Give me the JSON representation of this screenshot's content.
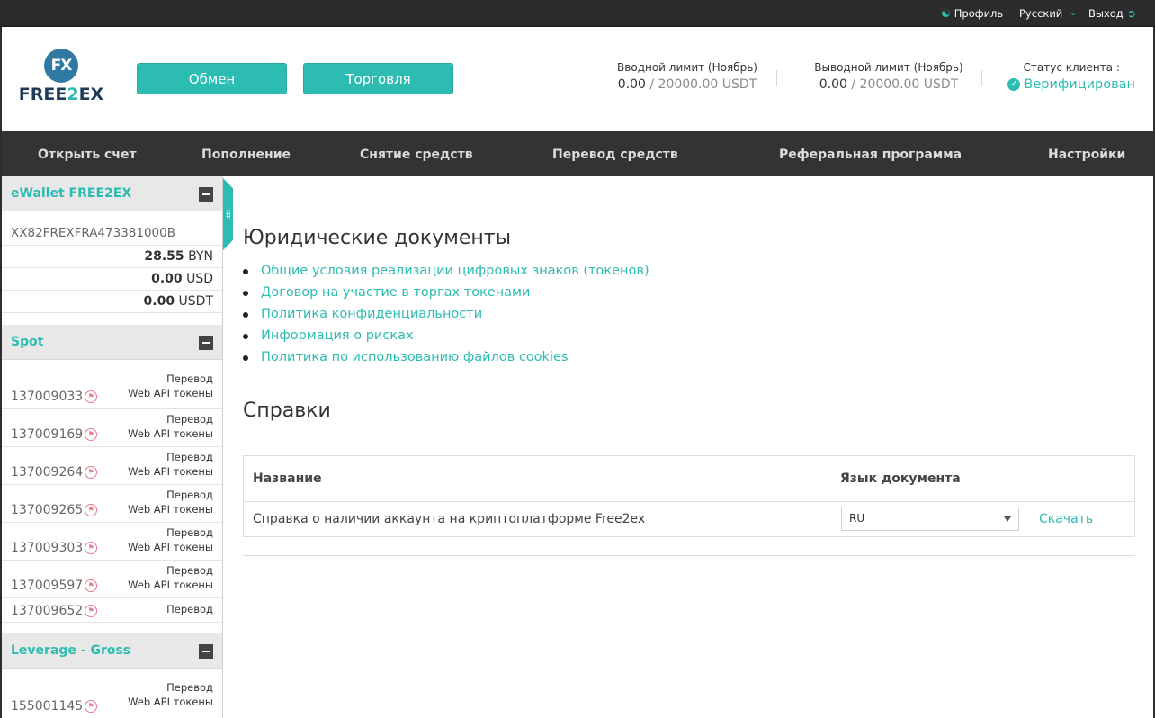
{
  "topbar": {
    "profile": "Профиль",
    "language": "Русский",
    "logout": "Выход"
  },
  "logo": {
    "mark": "FX",
    "text_a": "FREE",
    "text_b": "2",
    "text_c": "EX"
  },
  "header": {
    "exchange_button": "Обмен",
    "trade_button": "Торговля",
    "input_limit": {
      "label": "Вводной лимит (Ноябрь)",
      "used": "0.00",
      "sep": " / ",
      "max": "20000.00 USDT"
    },
    "output_limit": {
      "label": "Выводной лимит (Ноябрь)",
      "used": "0.00",
      "sep": " / ",
      "max": "20000.00 USDT"
    },
    "status": {
      "label": "Статус клиента :",
      "value": "Верифицирован"
    }
  },
  "nav": {
    "items": [
      "Открыть счет",
      "Пополнение",
      "Снятие средств",
      "Перевод средств",
      "Реферальная программа",
      "Настройки"
    ]
  },
  "sidebar": {
    "ewallet": {
      "title": "eWallet FREE2EX",
      "account": "XX82FREXFRA473381000B",
      "balances": [
        {
          "amount": "28.55",
          "currency": "BYN"
        },
        {
          "amount": "0.00",
          "currency": "USD"
        },
        {
          "amount": "0.00",
          "currency": "USDT"
        }
      ]
    },
    "spot": {
      "title": "Spot",
      "transfer": "Перевод",
      "api": "Web API токены",
      "accounts": [
        "137009033",
        "137009169",
        "137009264",
        "137009265",
        "137009303",
        "137009597",
        "137009652"
      ]
    },
    "leverage": {
      "title": "Leverage - Gross",
      "transfer": "Перевод",
      "api": "Web API токены",
      "accounts": [
        "155001145"
      ]
    }
  },
  "main": {
    "legal_title": "Юридические документы",
    "documents": [
      "Общие условия реализации цифровых знаков (токенов)",
      "Договор на участие в торгах токенами",
      "Политика конфиденциальности",
      "Информация о рисках",
      "Политика по использованию файлов cookies"
    ],
    "refs_title": "Справки",
    "table": {
      "col_name": "Название",
      "col_lang": "Язык документа",
      "row_name": "Справка о наличии аккаунта на криптоплатформе Free2ex",
      "row_lang": "RU",
      "row_action": "Скачать"
    }
  },
  "colors": {
    "accent": "#2dbcb1",
    "nav_bg": "#333333",
    "topbar_bg": "#2b2b2b"
  }
}
